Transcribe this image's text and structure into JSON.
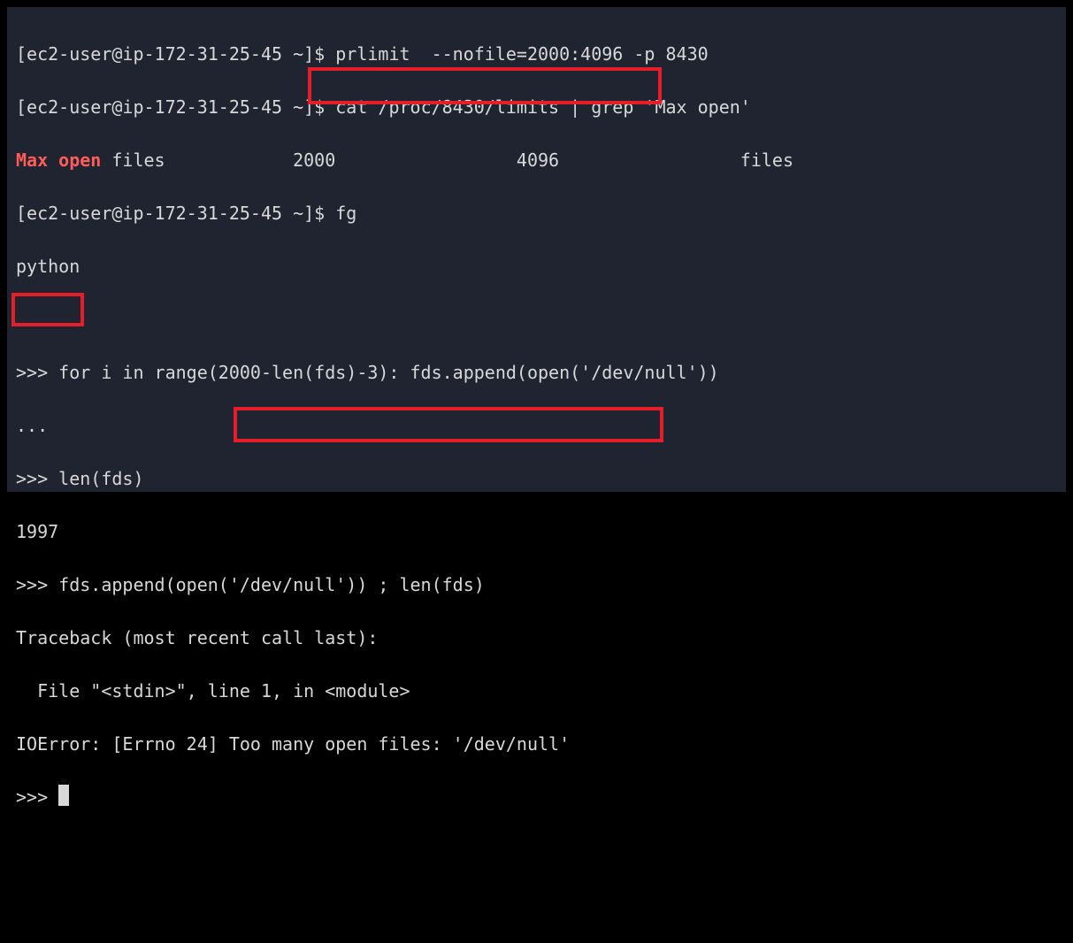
{
  "lines": {
    "l1_prompt": "[ec2-user@ip-172-31-25-45 ~]$ ",
    "l1_cmd": "prlimit  --nofile=2000:4096 -p 8430",
    "l2_prompt": "[ec2-user@ip-172-31-25-45 ~]$ ",
    "l2_cmd": "cat /proc/8430/limits | grep 'Max open'",
    "l3_maxopen": "Max open",
    "l3_rest": " files            2000                 4096                 files",
    "l4_prompt": "[ec2-user@ip-172-31-25-45 ~]$ ",
    "l4_cmd": "fg",
    "l5": "python",
    "l6": "",
    "l7": "",
    "l8": ">>> for i in range(2000-len(fds)-3): fds.append(open('/dev/null'))",
    "l9": "...",
    "l10": ">>> len(fds)",
    "l11": "1997",
    "l12": ">>> fds.append(open('/dev/null')) ; len(fds)",
    "l13": "Traceback (most recent call last):",
    "l14": "  File \"<stdin>\", line 1, in <module>",
    "l15": "IOError: [Errno 24] Too many open files: '/dev/null'",
    "l16": ">>> "
  }
}
